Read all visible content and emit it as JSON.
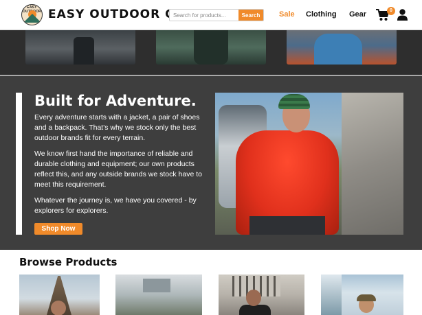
{
  "header": {
    "logo_text": "EASY OUTDOOR",
    "brand": "EASY OUTDOOR CO.",
    "search": {
      "placeholder": "Search for products...",
      "button_label": "Search"
    },
    "nav": {
      "sale": "Sale",
      "clothing": "Clothing",
      "gear": "Gear"
    },
    "cart_count": "0",
    "accent_color": "#f08a2a",
    "icons": {
      "cart": "cart-icon",
      "user": "user-icon"
    }
  },
  "hero": {
    "title": "Built for Adventure.",
    "paragraphs": [
      "Every adventure starts with a jacket, a pair of shoes and a backpack. That's why we stock only the best outdoor brands fit for every terrain.",
      "We know first hand the importance of reliable and durable clothing and equipment; our own products reflect this, and any outside brands we stock have to meet this requirement.",
      "Whatever the journey is, we have you covered - by explorers for explorers."
    ],
    "cta": "Shop Now"
  },
  "browse": {
    "title": "Browse Products"
  }
}
